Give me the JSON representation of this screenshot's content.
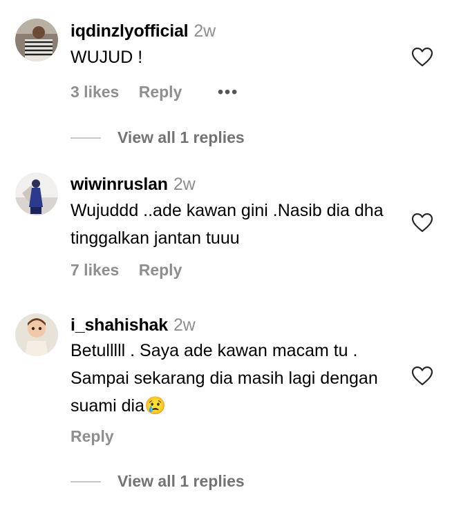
{
  "comments": [
    {
      "username": "iqdinzlyofficial",
      "time": "2w",
      "text": "WUJUD !",
      "likes": "3 likes",
      "reply_label": "Reply",
      "more": "•••",
      "view_replies": "View all 1 replies"
    },
    {
      "username": "wiwinruslan",
      "time": "2w",
      "text": "Wujuddd ..ade kawan gini .Nasib dia dha tinggalkan jantan tuuu",
      "likes": "7 likes",
      "reply_label": "Reply"
    },
    {
      "username": "i_shahishak",
      "time": "2w",
      "text": "Betulllll . Saya ade kawan macam tu . Sampai sekarang dia masih lagi dengan suami dia😢",
      "reply_label": "Reply",
      "view_replies": "View all 1 replies"
    }
  ],
  "icons": {
    "like": "heart-outline-icon",
    "more": "more-horizontal-icon"
  },
  "colors": {
    "secondary_text": "#8e8e8e",
    "divider": "#c7c7c7"
  }
}
